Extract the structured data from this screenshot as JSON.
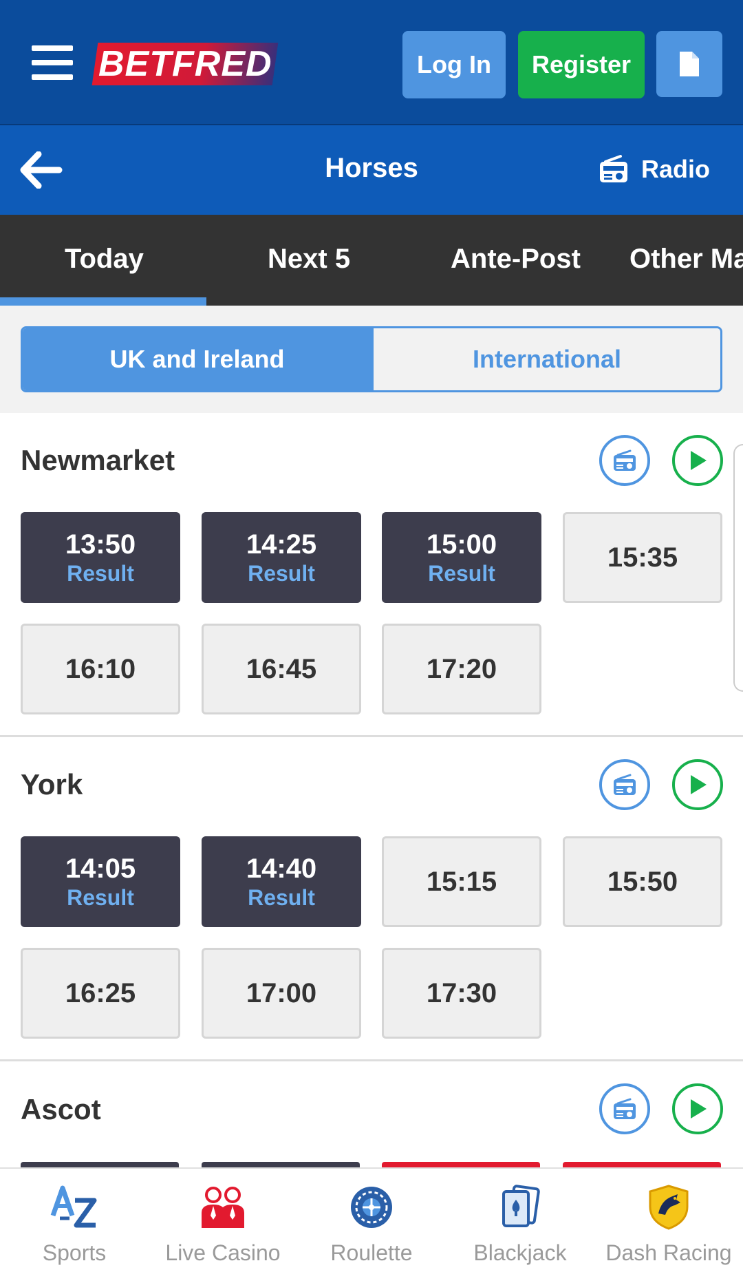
{
  "header": {
    "logo_text": "BETFRED",
    "login_label": "Log In",
    "register_label": "Register"
  },
  "subheader": {
    "title": "Horses",
    "radio_label": "Radio"
  },
  "tabs": [
    {
      "label": "Today",
      "active": true
    },
    {
      "label": "Next 5"
    },
    {
      "label": "Ante-Post"
    },
    {
      "label": "Other Ma"
    }
  ],
  "regions": {
    "active": "UK and Ireland",
    "inactive": "International"
  },
  "meetings": [
    {
      "name": "Newmarket",
      "races": [
        {
          "time": "13:50",
          "status": "Result"
        },
        {
          "time": "14:25",
          "status": "Result"
        },
        {
          "time": "15:00",
          "status": "Result"
        },
        {
          "time": "15:35"
        },
        {
          "time": "16:10"
        },
        {
          "time": "16:45"
        },
        {
          "time": "17:20"
        }
      ]
    },
    {
      "name": "York",
      "races": [
        {
          "time": "14:05",
          "status": "Result"
        },
        {
          "time": "14:40",
          "status": "Result"
        },
        {
          "time": "15:15"
        },
        {
          "time": "15:50"
        },
        {
          "time": "16:25"
        },
        {
          "time": "17:00"
        },
        {
          "time": "17:30"
        }
      ]
    },
    {
      "name": "Ascot"
    }
  ],
  "bottom_nav": [
    {
      "label": "Sports",
      "icon": "az-icon"
    },
    {
      "label": "Live Casino",
      "icon": "dealers-icon"
    },
    {
      "label": "Roulette",
      "icon": "roulette-icon"
    },
    {
      "label": "Blackjack",
      "icon": "cards-icon"
    },
    {
      "label": "Dash Racing",
      "icon": "horse-shield-icon"
    }
  ],
  "colors": {
    "header_bg": "#0b4c9c",
    "subheader_bg": "#0e5bb8",
    "accent_blue": "#4f95e0",
    "register_green": "#17b04c",
    "result_tile": "#3d3d4d",
    "tabs_bg": "#333333"
  }
}
